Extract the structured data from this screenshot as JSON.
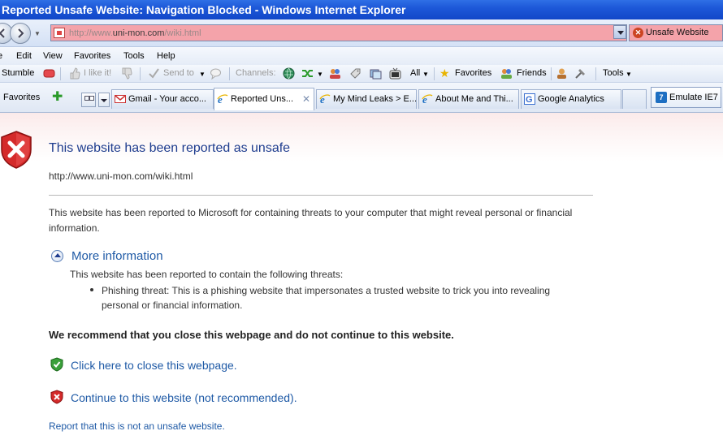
{
  "window": {
    "title": "Reported Unsafe Website: Navigation Blocked - Windows Internet Explorer"
  },
  "address": {
    "url_prefix": "http://www.",
    "url_domain": "uni-mon.com",
    "url_suffix": "/wiki.html",
    "status_badge": "Unsafe Website",
    "status_color": "#f4a3aa"
  },
  "menu": [
    "e",
    "Edit",
    "View",
    "Favorites",
    "Tools",
    "Help"
  ],
  "toolbar": {
    "stumble": "Stumble",
    "like": "I like it!",
    "send_to": "Send to",
    "channels": "Channels:",
    "all": "All",
    "favorites": "Favorites",
    "friends": "Friends",
    "tools": "Tools"
  },
  "tabs_bar": {
    "favorites_label": "Favorites",
    "tabs": [
      {
        "label": "Gmail - Your acco...",
        "icon": "gmail-icon"
      },
      {
        "label": "Reported Uns...",
        "icon": "ie-icon",
        "active": true
      },
      {
        "label": "My Mind Leaks > E...",
        "icon": "ie-icon"
      },
      {
        "label": "About Me and Thi...",
        "icon": "ie-icon"
      },
      {
        "label": "Google Analytics",
        "icon": "google-icon"
      }
    ],
    "emulate": "Emulate IE7"
  },
  "page": {
    "title": "This website has been reported as unsafe",
    "url": "http://www.uni-mon.com/wiki.html",
    "body": "This website has been reported to Microsoft for containing threats to your computer that might reveal personal or financial information.",
    "more_info": "More information",
    "threat_intro": "This website has been reported to contain the following threats:",
    "threat": "Phishing threat: This is a phishing website that impersonates a trusted website to trick you into revealing personal or financial information.",
    "recommend": "We recommend that you close this webpage and do not continue to this website.",
    "close_link": "Click here to close this webpage.",
    "continue_link": "Continue to this website (not recommended).",
    "report_link": "Report that this is not an unsafe website."
  }
}
